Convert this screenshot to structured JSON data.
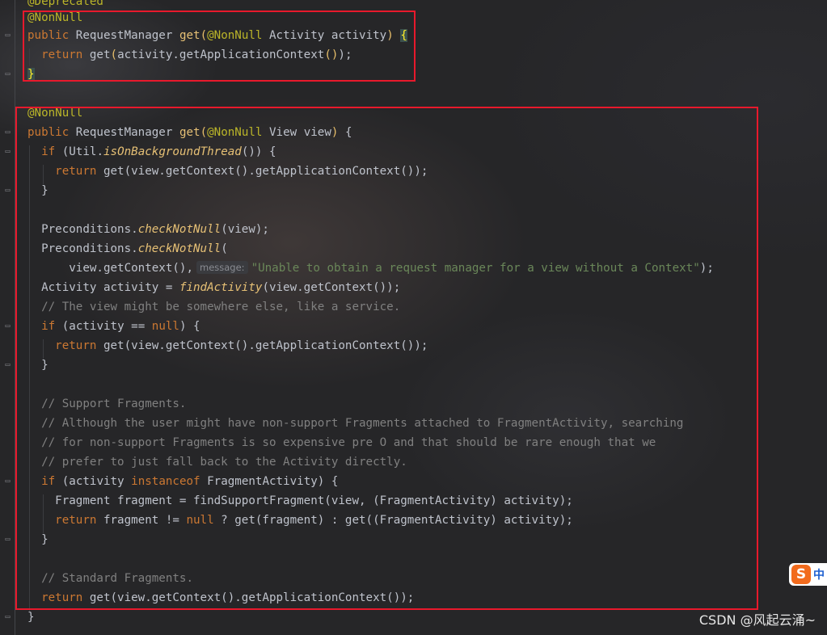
{
  "code": {
    "l0": {
      "ann": "@Deprecated"
    },
    "l1": {
      "ann": "@NonNull"
    },
    "l2": {
      "kw": "public",
      "type": "RequestManager",
      "method": "get",
      "open": "(",
      "ann": "@NonNull",
      "ptype": "Activity",
      "pname": "activity",
      "close": ")",
      "brace": "{"
    },
    "l3": {
      "kw": "return",
      "call": "get",
      "open": "(",
      "arg": "activity.getApplicationContext",
      "parens": "()",
      "close": ");"
    },
    "l4": {
      "brace": "}"
    },
    "l6": {
      "ann": "@NonNull"
    },
    "l7": {
      "kw": "public",
      "type": "RequestManager",
      "method": "get",
      "open": "(",
      "ann": "@NonNull",
      "ptype": "View",
      "pname": "view",
      "close": ")",
      "brace": "{"
    },
    "l8": {
      "kw": "if",
      "open": "(Util.",
      "call": "isOnBackgroundThread",
      "close": "()) {"
    },
    "l9": {
      "kw": "return",
      "text": "get(view.getContext().getApplicationContext());"
    },
    "l10": {
      "brace": "}"
    },
    "l12": {
      "cls": "Preconditions.",
      "call": "checkNotNull",
      "rest": "(view);"
    },
    "l13": {
      "cls": "Preconditions.",
      "call": "checkNotNull",
      "rest": "("
    },
    "l14": {
      "text": "view.getContext(),",
      "hint": "message:",
      "str": "\"Unable to obtain a request manager for a view without a Context\"",
      "close": ");"
    },
    "l15": {
      "text": "Activity activity = ",
      "call": "findActivity",
      "rest": "(view.getContext());"
    },
    "l16": {
      "comment": "// The view might be somewhere else, like a service."
    },
    "l17": {
      "kw": "if",
      "text1": "(activity == ",
      "kw2": "null",
      "text2": ") {"
    },
    "l18": {
      "kw": "return",
      "text": "get(view.getContext().getApplicationContext());"
    },
    "l19": {
      "brace": "}"
    },
    "l21": {
      "comment": "// Support Fragments."
    },
    "l22": {
      "comment": "// Although the user might have non-support Fragments attached to FragmentActivity, searching"
    },
    "l23": {
      "comment": "// for non-support Fragments is so expensive pre O and that should be rare enough that we"
    },
    "l24": {
      "comment": "// prefer to just fall back to the Activity directly."
    },
    "l25": {
      "kw": "if",
      "text1": "(activity ",
      "kw2": "instanceof",
      "text2": " FragmentActivity) {"
    },
    "l26": {
      "text": "Fragment fragment = findSupportFragment(view, (FragmentActivity) activity);"
    },
    "l27": {
      "kw": "return",
      "text1": "fragment != ",
      "kw2": "null",
      "text2": " ? get(fragment) : get((FragmentActivity) activity);"
    },
    "l28": {
      "brace": "}"
    },
    "l30": {
      "comment": "// Standard Fragments."
    },
    "l31": {
      "kw": "return",
      "text": "get(view.getContext().getApplicationContext());"
    },
    "l32": {
      "brace": "}"
    }
  },
  "watermark": "CSDN @风起云涌~",
  "ime": {
    "logo": "S",
    "label": "中"
  },
  "colors": {
    "highlight_box": "#e8192c",
    "keyword": "#cc7832",
    "annotation": "#bbb529",
    "comment": "#808080",
    "string": "#6a8759"
  }
}
